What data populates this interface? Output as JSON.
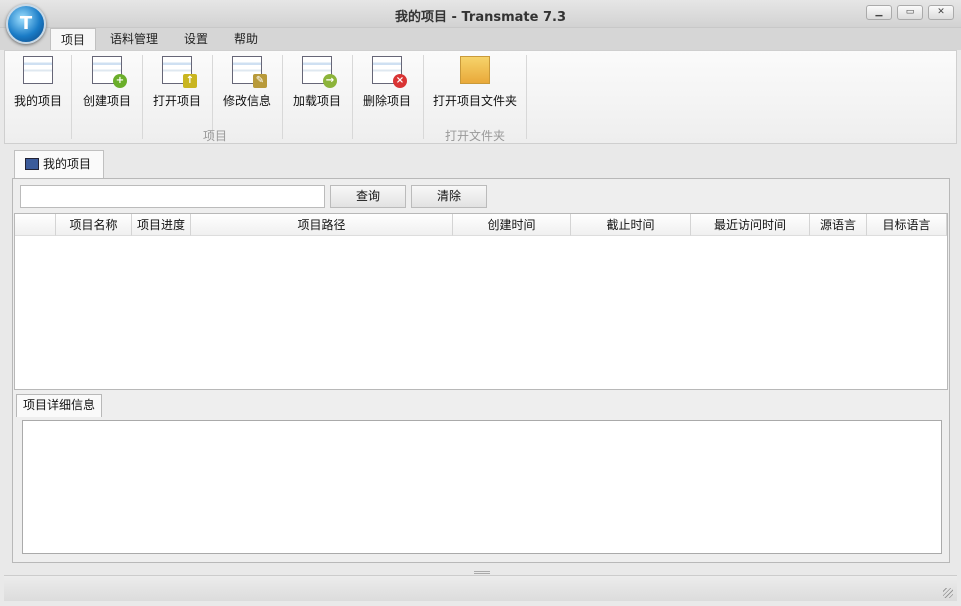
{
  "window": {
    "title": "我的项目 - Transmate 7.3",
    "logo_letter": "T"
  },
  "menu_tabs": [
    {
      "label": "项目"
    },
    {
      "label": "语料管理"
    },
    {
      "label": "设置"
    },
    {
      "label": "帮助"
    }
  ],
  "ribbon": {
    "buttons": [
      {
        "label": "我的项目"
      },
      {
        "label": "创建项目"
      },
      {
        "label": "打开项目"
      },
      {
        "label": "修改信息"
      },
      {
        "label": "加载项目"
      },
      {
        "label": "删除项目"
      },
      {
        "label": "打开项目文件夹"
      }
    ],
    "groups": [
      {
        "label": "项目"
      },
      {
        "label": "打开文件夹"
      }
    ]
  },
  "doc_tab": {
    "label": "我的项目"
  },
  "search": {
    "value": "",
    "query_label": "查询",
    "clear_label": "清除"
  },
  "table": {
    "columns": [
      "",
      "项目名称",
      "项目进度",
      "项目路径",
      "创建时间",
      "截止时间",
      "最近访问时间",
      "源语言",
      "目标语言"
    ],
    "rows": []
  },
  "detail": {
    "tab_label": "项目详细信息"
  }
}
